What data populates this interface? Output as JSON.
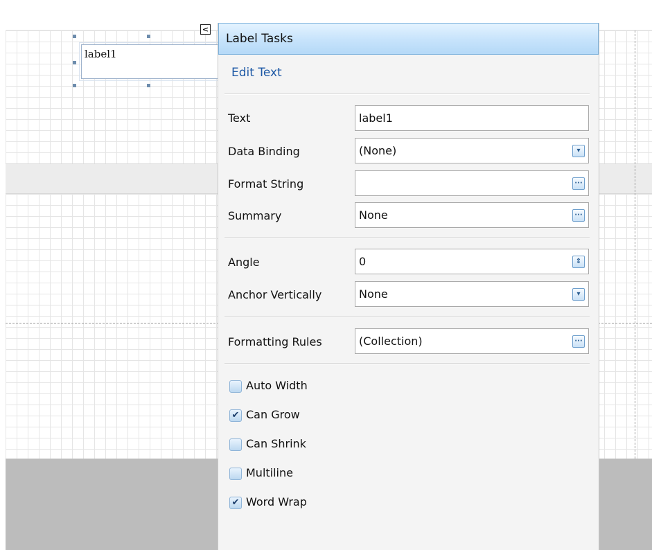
{
  "canvas": {
    "label_text": "label1"
  },
  "panel": {
    "title": "Label Tasks",
    "edit_link": "Edit Text",
    "properties": [
      {
        "label": "Text",
        "value": "label1",
        "button": ""
      },
      {
        "label": "Data Binding",
        "value": "(None)",
        "button": "dropdown-icon"
      },
      {
        "label": "Format String",
        "value": "",
        "button": "ellipsis-icon"
      },
      {
        "label": "Summary",
        "value": "None",
        "button": "ellipsis-icon"
      },
      {
        "label": "Angle",
        "value": "0",
        "button": "spinner-icon"
      },
      {
        "label": "Anchor Vertically",
        "value": "None",
        "button": "dropdown-icon"
      },
      {
        "label": "Formatting Rules",
        "value": "(Collection)",
        "button": "ellipsis-icon"
      }
    ],
    "checkboxes": [
      {
        "label": "Auto Width",
        "checked": false
      },
      {
        "label": "Can Grow",
        "checked": true
      },
      {
        "label": "Can Shrink",
        "checked": false
      },
      {
        "label": "Multiline",
        "checked": false
      },
      {
        "label": "Word Wrap",
        "checked": true
      }
    ]
  },
  "icons": {
    "dropdown": "▾",
    "ellipsis": "···",
    "spinner": "⇕",
    "check": "✔",
    "smart_tag": "<"
  }
}
